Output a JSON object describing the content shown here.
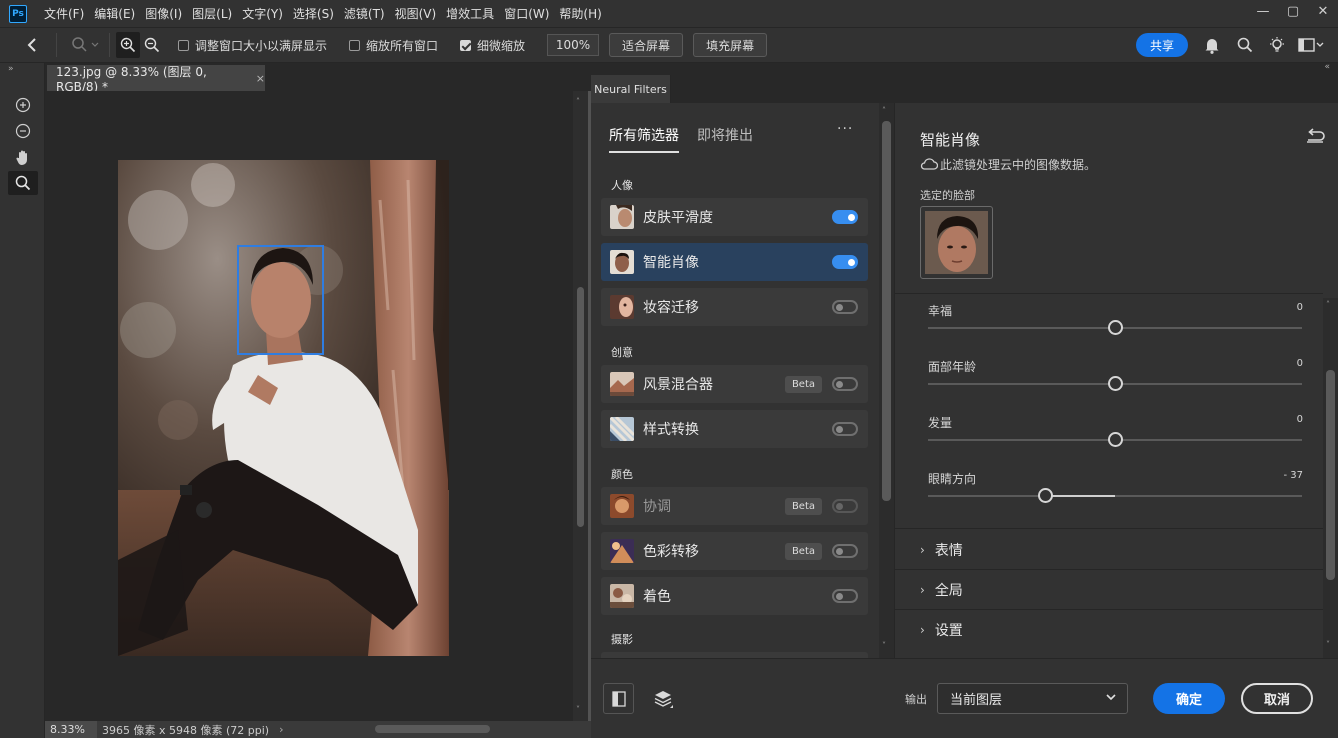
{
  "app": {
    "logo_text": "Ps"
  },
  "menus": [
    "文件(F)",
    "编辑(E)",
    "图像(I)",
    "图层(L)",
    "文字(Y)",
    "选择(S)",
    "滤镜(T)",
    "视图(V)",
    "增效工具",
    "窗口(W)",
    "帮助(H)"
  ],
  "window_controls": {
    "minimize": "—",
    "restore": "▢",
    "close": "✕"
  },
  "options": {
    "resize_windows_label": "调整窗口大小以满屏显示",
    "zoom_all_label": "缩放所有窗口",
    "scrubby_zoom_label": "细微缩放",
    "scrubby_zoom_checked": true,
    "zoom_value": "100%",
    "fit_screen": "适合屏幕",
    "fill_screen": "填充屏幕",
    "share": "共享"
  },
  "document": {
    "tab_title": "123.jpg @ 8.33% (图层 0, RGB/8) *",
    "close": "×",
    "zoom": "8.33%",
    "info": "3965 像素 x 5948 像素 (72 ppi)",
    "arrow": "›"
  },
  "neural": {
    "panel_tab": "Neural Filters",
    "tabs": [
      "所有筛选器",
      "即将推出"
    ],
    "more": "···",
    "categories": {
      "portrait": "人像",
      "creative": "创意",
      "color": "颜色",
      "photo": "摄影"
    },
    "filters": [
      {
        "name": "皮肤平滑度",
        "on": true,
        "beta": false,
        "thumb": "skin-thumb"
      },
      {
        "name": "智能肖像",
        "on": true,
        "beta": false,
        "thumb": "portrait-thumb"
      },
      {
        "name": "妆容迁移",
        "on": false,
        "beta": false,
        "thumb": "makeup-thumb"
      },
      {
        "name": "风景混合器",
        "on": false,
        "beta": true,
        "thumb": "landscape-thumb"
      },
      {
        "name": "样式转换",
        "on": false,
        "beta": false,
        "thumb": "style-thumb"
      },
      {
        "name": "协调",
        "on": false,
        "beta": true,
        "thumb": "harmony-thumb"
      },
      {
        "name": "色彩转移",
        "on": false,
        "beta": true,
        "thumb": "color-transfer-thumb"
      },
      {
        "name": "着色",
        "on": false,
        "beta": false,
        "thumb": "colorize-thumb"
      }
    ],
    "beta_label": "Beta",
    "detail": {
      "title": "智能肖像",
      "subtitle": "此滤镜处理云中的图像数据。",
      "selected_face_label": "选定的脸部",
      "sliders": [
        {
          "label": "幸福",
          "value": "0",
          "level": 0
        },
        {
          "label": "面部年龄",
          "value": "0",
          "level": 0
        },
        {
          "label": "发量",
          "value": "0",
          "level": 0
        },
        {
          "label": "眼睛方向",
          "value": "- 37",
          "level": -37
        }
      ],
      "sections": [
        "表情",
        "全局",
        "设置"
      ]
    },
    "output_label": "输出",
    "output_value": "当前图层",
    "ok": "确定",
    "cancel": "取消"
  },
  "colors": {
    "accent": "#1473e6",
    "toggle_on": "#378ef0",
    "selected_row": "#29415e",
    "face_box": "#2f7de1"
  }
}
